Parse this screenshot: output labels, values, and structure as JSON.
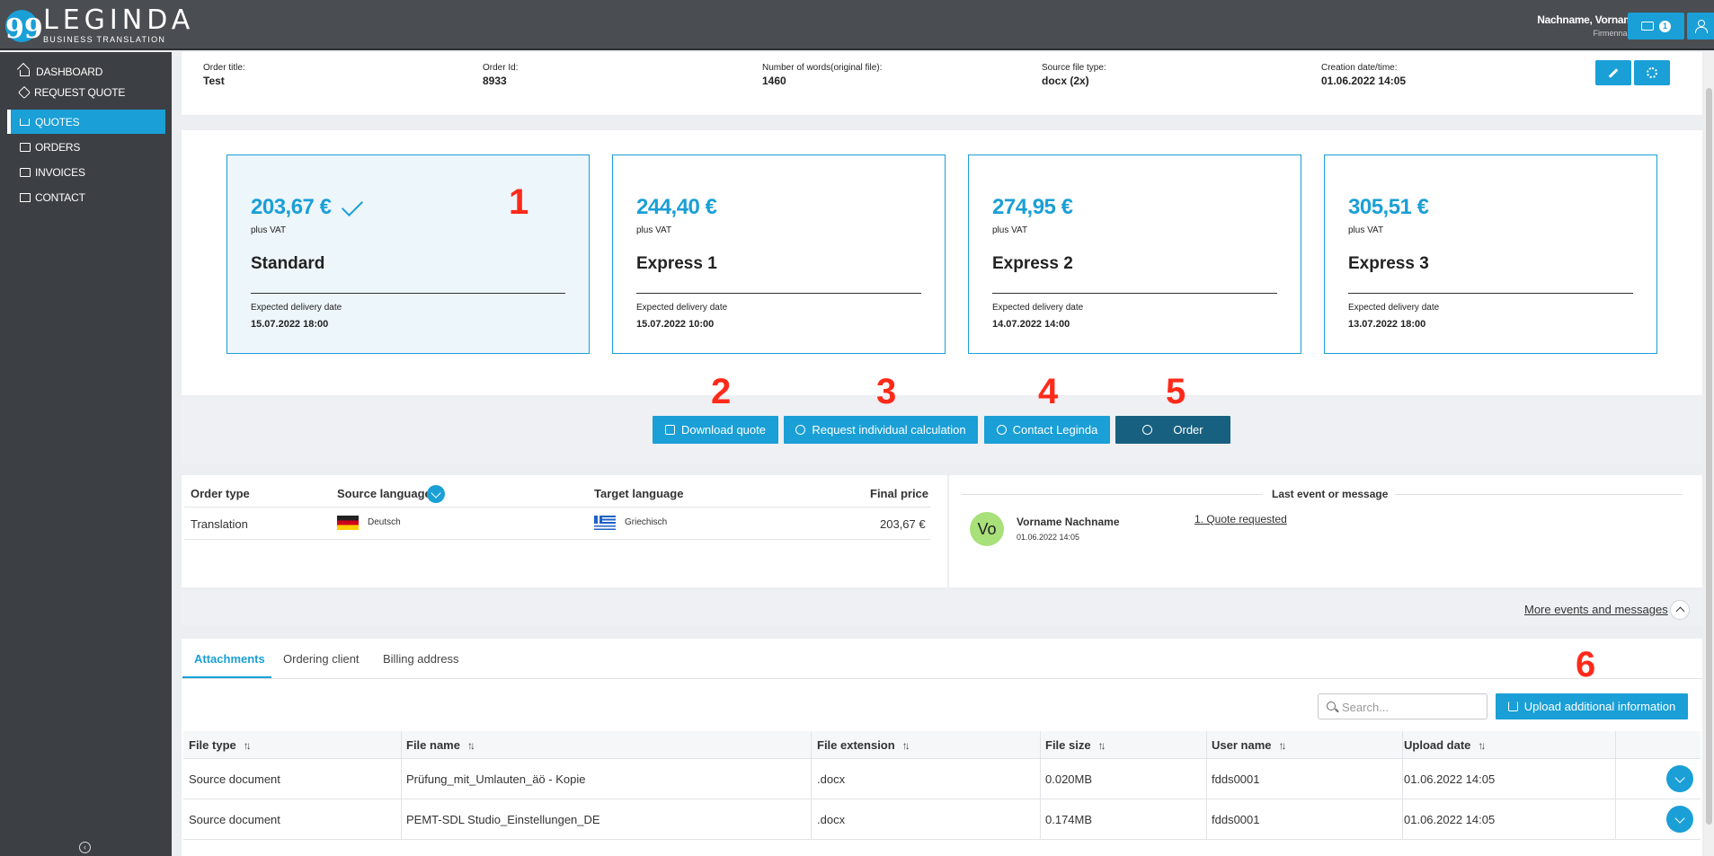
{
  "brand": {
    "name": "LEGINDA",
    "tagline": "BUSINESS TRANSLATION",
    "mark": "99"
  },
  "user": {
    "name": "Nachname, Vorname",
    "company": "Firmenname",
    "notifications": "1"
  },
  "sidebar": {
    "items": [
      {
        "label": "DASHBOARD",
        "icon": "home-icon"
      },
      {
        "label": "REQUEST QUOTE",
        "icon": "tag-icon"
      },
      {
        "label": "QUOTES",
        "icon": "cart-icon",
        "active": true
      },
      {
        "label": "ORDERS",
        "icon": "box-icon"
      },
      {
        "label": "INVOICES",
        "icon": "invoice-icon"
      },
      {
        "label": "CONTACT",
        "icon": "mail-icon"
      }
    ],
    "collapse_icon": "‹"
  },
  "order": {
    "title_label": "Order title:",
    "title": "Test",
    "id_label": "Order Id:",
    "id": "8933",
    "words_label": "Number of words(original file):",
    "words": "1460",
    "filetype_label": "Source file type:",
    "filetype": "docx (2x)",
    "created_label": "Creation date/time:",
    "created": "01.06.2022 14:05"
  },
  "quotes": [
    {
      "price": "203,67 €",
      "vat": "plus VAT",
      "name": "Standard",
      "delivery_label": "Expected delivery date",
      "delivery": "15.07.2022 18:00",
      "selected": true
    },
    {
      "price": "244,40 €",
      "vat": "plus VAT",
      "name": "Express 1",
      "delivery_label": "Expected delivery date",
      "delivery": "15.07.2022 10:00"
    },
    {
      "price": "274,95 €",
      "vat": "plus VAT",
      "name": "Express 2",
      "delivery_label": "Expected delivery date",
      "delivery": "14.07.2022 14:00"
    },
    {
      "price": "305,51 €",
      "vat": "plus VAT",
      "name": "Express 3",
      "delivery_label": "Expected delivery date",
      "delivery": "13.07.2022 18:00"
    }
  ],
  "annotations": [
    "1",
    "2",
    "3",
    "4",
    "5",
    "6"
  ],
  "actions": {
    "download": "Download quote",
    "individual": "Request individual calculation",
    "contact": "Contact Leginda",
    "order": "Order"
  },
  "lang_table": {
    "headers": {
      "order_type": "Order type",
      "source": "Source language",
      "target": "Target language",
      "price": "Final price"
    },
    "row": {
      "order_type": "Translation",
      "source": "Deutsch",
      "target": "Griechisch",
      "price": "203,67 €"
    }
  },
  "events": {
    "title": "Last event or message",
    "avatar": "Vo",
    "author": "Vorname Nachname",
    "date": "01.06.2022 14:05",
    "item": "1. Quote requested",
    "more": "More events and messages"
  },
  "tabs": [
    "Attachments",
    "Ordering client",
    "Billing address"
  ],
  "search": {
    "placeholder": "Search..."
  },
  "upload_label": "Upload additional information",
  "files": {
    "headers": [
      "File type",
      "File name",
      "File extension",
      "File size",
      "User name",
      "Upload date"
    ],
    "rows": [
      [
        "Source document",
        "Prüfung_mit_Umlauten_äö - Kopie",
        ".docx",
        "0.020MB",
        "fdds0001",
        "01.06.2022 14:05"
      ],
      [
        "Source document",
        "PEMT-SDL Studio_Einstellungen_DE",
        ".docx",
        "0.174MB",
        "fdds0001",
        "01.06.2022 14:05"
      ]
    ]
  },
  "colors": {
    "accent": "#1a9fd6",
    "dark_button": "#17607f",
    "annotation": "#ff2a1a",
    "sidebar": "#3c3f44"
  }
}
